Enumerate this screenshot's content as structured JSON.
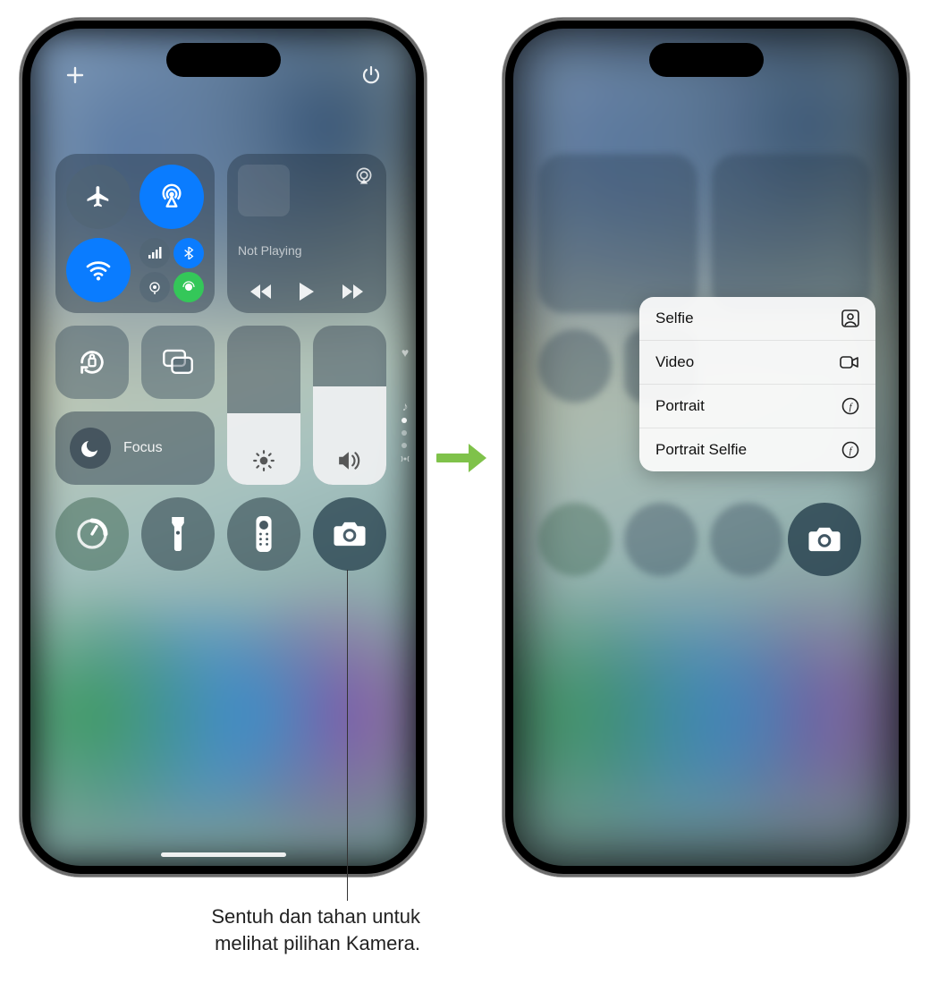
{
  "labels": {
    "not_playing": "Not Playing",
    "focus": "Focus"
  },
  "camera_menu": {
    "selfie": "Selfie",
    "video": "Video",
    "portrait": "Portrait",
    "portrait_selfie": "Portrait Selfie"
  },
  "callout": {
    "line1": "Sentuh dan tahan untuk",
    "line2": "melihat pilihan Kamera."
  },
  "icons": {
    "add": "add-icon",
    "power": "power-icon",
    "airplane": "airplane-icon",
    "airdrop": "airdrop-icon",
    "wifi": "wifi-icon",
    "cellular": "cellular-icon",
    "bluetooth": "bluetooth-icon",
    "hotspot": "hotspot-icon",
    "satellite": "satellite-icon",
    "airplay": "airplay-icon",
    "rewind": "rewind-icon",
    "play": "play-icon",
    "forward": "forward-icon",
    "rotation_lock": "rotation-lock-icon",
    "screen_mirror": "screen-mirror-icon",
    "moon": "moon-icon",
    "brightness": "brightness-icon",
    "volume": "volume-icon",
    "heart": "heart-icon",
    "music": "music-note-icon",
    "antenna": "antenna-icon",
    "timer": "timer-icon",
    "flashlight": "flashlight-icon",
    "remote": "remote-icon",
    "camera": "camera-icon",
    "person_square": "person-square-icon",
    "video_cam": "video-camera-icon",
    "aperture": "aperture-icon"
  },
  "colors": {
    "active_blue": "#0a7cff",
    "active_green": "#34c759",
    "arrow_green": "#7fc24a"
  },
  "sliders": {
    "brightness_pct": 45,
    "volume_pct": 62
  }
}
